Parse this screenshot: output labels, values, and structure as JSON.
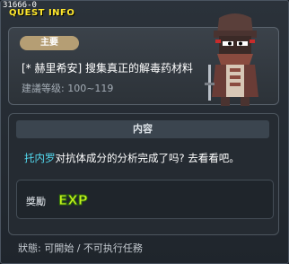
{
  "window": {
    "quest_id": "31666-0",
    "title": "QUEST INFO"
  },
  "quest": {
    "badge": "主要",
    "name": "[* 赫里希安] 搜集真正的解毒药材料",
    "level": "建議等级: 100~119"
  },
  "content": {
    "header": "内容",
    "npc_name": "托内罗",
    "description": "对抗体成分的分析完成了吗? 去看看吧。"
  },
  "reward": {
    "label": "獎勵",
    "exp_text": "EXP"
  },
  "status": {
    "text": "狀態: 可開始 / 不可执行任務"
  },
  "colors": {
    "title": "#ffe82d",
    "npc_name": "#53d9ef",
    "badge": "#b59e74",
    "exp": "#c8f21e"
  }
}
